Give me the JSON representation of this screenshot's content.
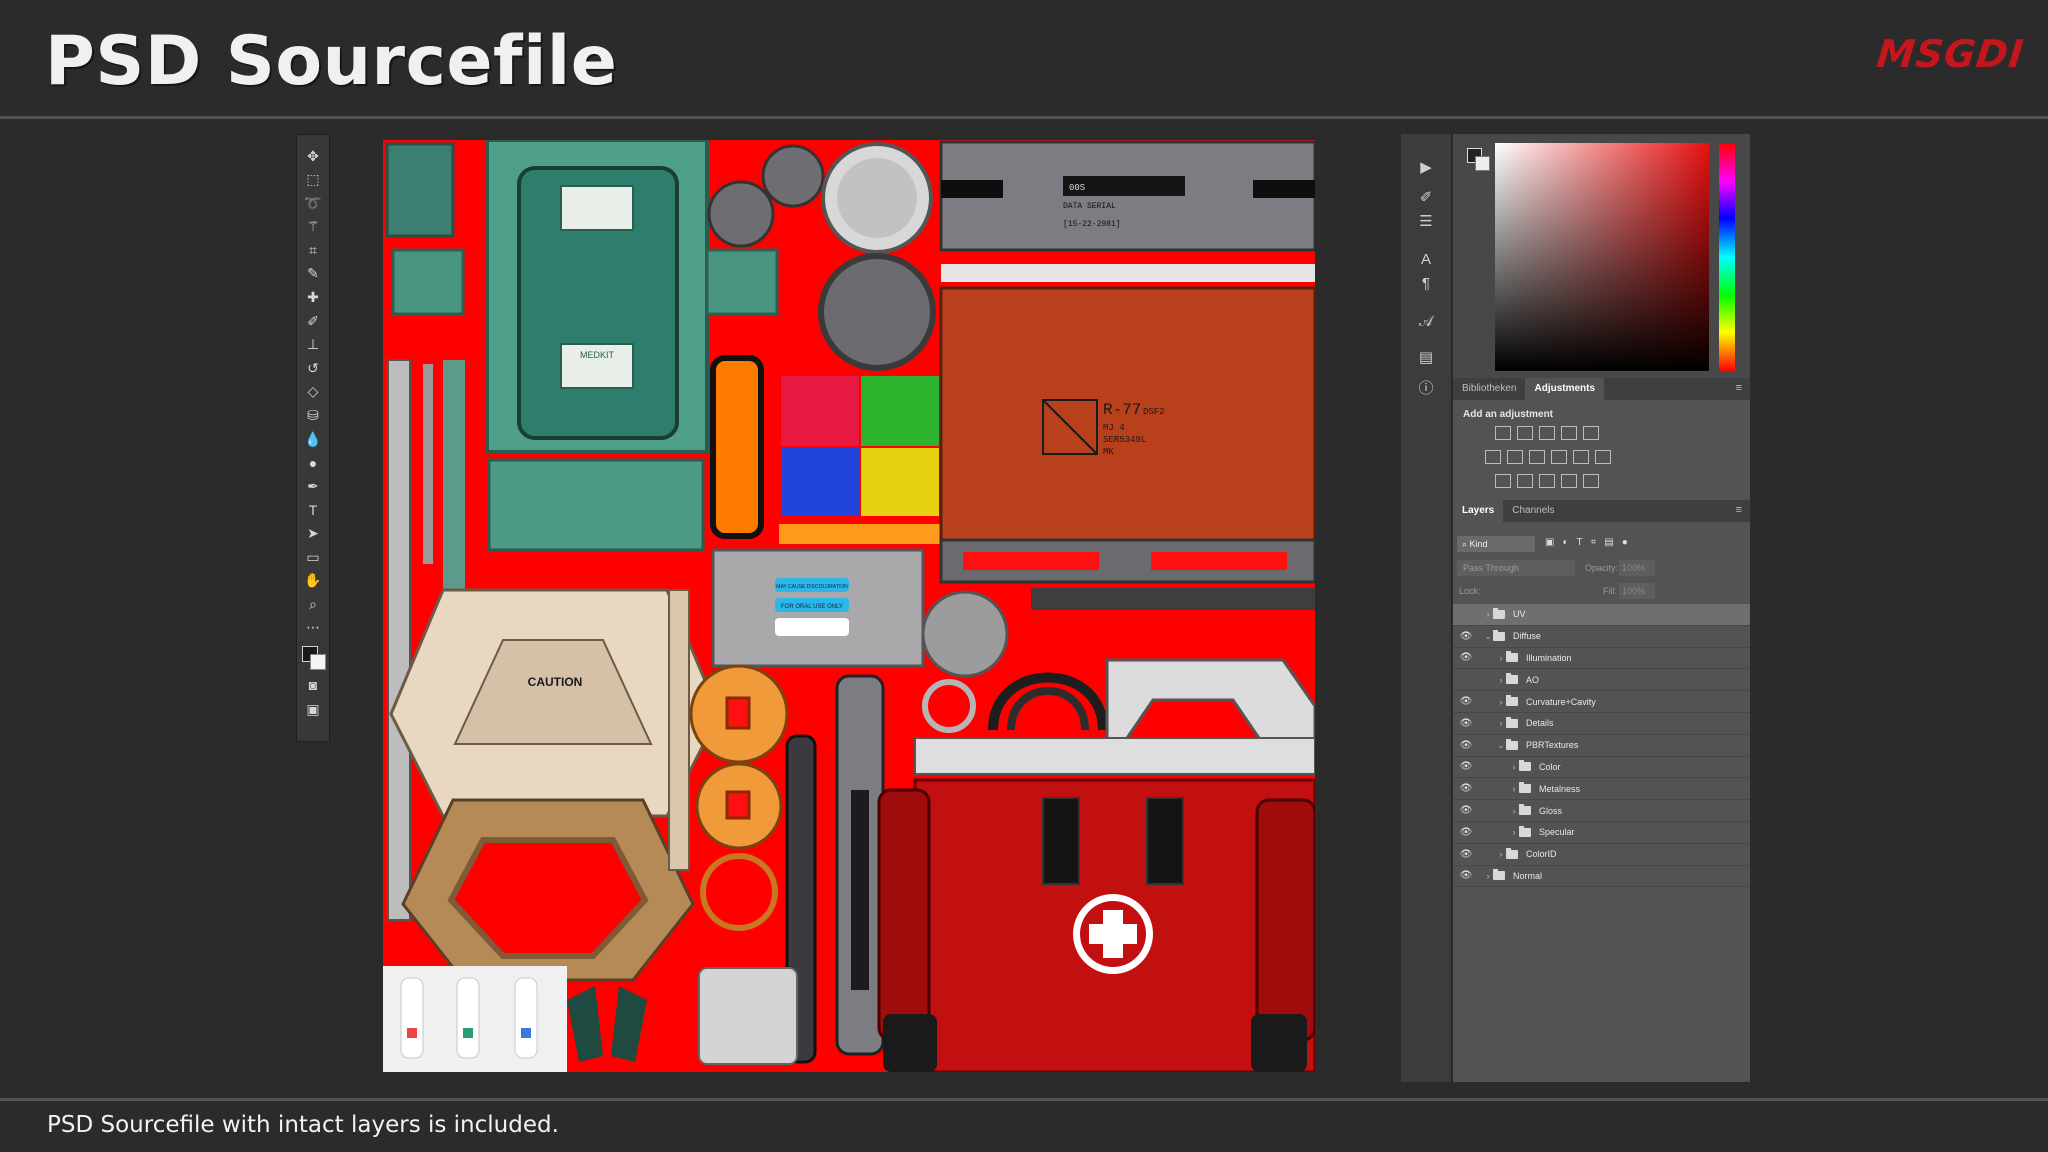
{
  "header": {
    "title": "PSD Sourcefile",
    "logo": "MSGDI",
    "caption": "PSD Sourcefile with intact layers is included."
  },
  "toolbar": {
    "tools": [
      "move-icon",
      "marquee-icon",
      "lasso-icon",
      "magic-wand-icon",
      "crop-icon",
      "eyedropper-icon",
      "healing-brush-icon",
      "brush-icon",
      "clone-stamp-icon",
      "history-brush-icon",
      "eraser-icon",
      "paint-bucket-icon",
      "blur-icon",
      "dodge-icon",
      "pen-icon",
      "type-icon",
      "path-selection-icon",
      "shape-icon",
      "hand-icon",
      "zoom-icon",
      "more-tools-icon"
    ]
  },
  "texture": {
    "caution_text": "CAUTION",
    "crate_code": "R-77",
    "crate_suffix": "DSF2",
    "crate_lines": [
      "MJ    4",
      "SER5349L",
      "MK"
    ],
    "panel_code": "00S",
    "panel_line1": "DATA SERIAL",
    "panel_line2": "[15-22-2981]",
    "label_blue_1": "MAY CAUSE DISCOLORATION",
    "label_blue_2": "FOR ORAL USE ONLY",
    "medkit_label": "MEDKIT",
    "colors": {
      "background": "#ff0000",
      "teal": "#3f8f7e",
      "orange_crate": "#b8401a",
      "cream": "#e9d8c1",
      "steel": "#9a9a9a"
    }
  },
  "picker": {
    "fg_color": "#222222",
    "bg_color": "#eeeeee"
  },
  "adjustments": {
    "tabs": [
      "Bibliotheken",
      "Adjustments"
    ],
    "active_tab": "Adjustments",
    "add_label": "Add an adjustment"
  },
  "layers_panel": {
    "tabs": [
      "Layers",
      "Channels"
    ],
    "active_tab": "Layers",
    "kind_label": "Kind",
    "blend_mode": "Pass Through",
    "opacity_label": "Opacity:",
    "opacity_value": "100%",
    "lock_label": "Lock:",
    "fill_label": "Fill:",
    "fill_value": "100%",
    "layers": [
      {
        "name": "UV",
        "visible": false,
        "indent": 0,
        "open": false,
        "selected": true
      },
      {
        "name": "Diffuse",
        "visible": true,
        "indent": 0,
        "open": true,
        "selected": false
      },
      {
        "name": "Illumination",
        "visible": true,
        "indent": 1,
        "open": false,
        "selected": false
      },
      {
        "name": "AO",
        "visible": false,
        "indent": 1,
        "open": false,
        "selected": false
      },
      {
        "name": "Curvature+Cavity",
        "visible": true,
        "indent": 1,
        "open": false,
        "selected": false
      },
      {
        "name": "Details",
        "visible": true,
        "indent": 1,
        "open": false,
        "selected": false
      },
      {
        "name": "PBRTextures",
        "visible": true,
        "indent": 1,
        "open": true,
        "selected": false
      },
      {
        "name": "Color",
        "visible": true,
        "indent": 2,
        "open": false,
        "selected": false
      },
      {
        "name": "Metalness",
        "visible": true,
        "indent": 2,
        "open": false,
        "selected": false
      },
      {
        "name": "Gloss",
        "visible": true,
        "indent": 2,
        "open": false,
        "selected": false
      },
      {
        "name": "Specular",
        "visible": true,
        "indent": 2,
        "open": false,
        "selected": false
      },
      {
        "name": "ColorID",
        "visible": true,
        "indent": 1,
        "open": false,
        "selected": false
      },
      {
        "name": "Normal",
        "visible": true,
        "indent": 0,
        "open": false,
        "selected": false
      }
    ]
  }
}
